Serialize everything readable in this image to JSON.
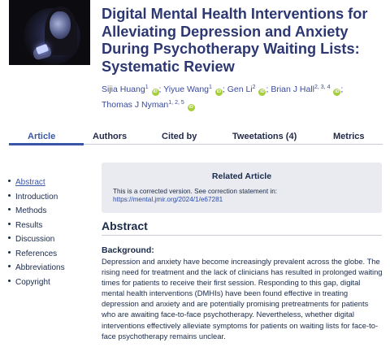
{
  "article": {
    "title": "Digital Mental Health Interventions for Alleviating Depression and Anxiety During Psychotherapy Waiting Lists: Systematic Review",
    "thumbnail_icon": "person-with-phone-image"
  },
  "authors": [
    {
      "name": "Sijia Huang",
      "sup": "1"
    },
    {
      "name": "Yiyue Wang",
      "sup": "1"
    },
    {
      "name": "Gen Li",
      "sup": "2"
    },
    {
      "name": "Brian J Hall",
      "sup": "2, 3, 4"
    },
    {
      "name": "Thomas J Nyman",
      "sup": "1, 2, 5"
    }
  ],
  "orcid_label": "iD",
  "tabs": [
    {
      "label": "Article",
      "active": true
    },
    {
      "label": "Authors"
    },
    {
      "label": "Cited by"
    },
    {
      "label": "Tweetations (4)"
    },
    {
      "label": "Metrics"
    }
  ],
  "toc": [
    {
      "label": "Abstract",
      "active": true
    },
    {
      "label": "Introduction"
    },
    {
      "label": "Methods"
    },
    {
      "label": "Results"
    },
    {
      "label": "Discussion"
    },
    {
      "label": "References"
    },
    {
      "label": "Abbreviations"
    },
    {
      "label": "Copyright"
    }
  ],
  "related": {
    "heading": "Related Article",
    "note": "This is a corrected version. See correction statement in:",
    "link": "https://mental.jmir.org/2024/1/e67281"
  },
  "abstract": {
    "heading": "Abstract",
    "background_heading": "Background:",
    "background_text": "Depression and anxiety have become increasingly prevalent across the globe. The rising need for treatment and the lack of clinicians has resulted in prolonged waiting times for patients to receive their first session. Responding to this gap, digital mental health interventions (DMHIs) have been found effective in treating depression and anxiety and are potentially promising pretreatments for patients who are awaiting face-to-face psychotherapy. Nevertheless, whether digital interventions effectively alleviate symptoms for patients on waiting lists for face-to-face psychotherapy remains unclear."
  },
  "colors": {
    "title": "#2d3873",
    "link": "#3a56a8",
    "orcid": "#a6ce39",
    "panel": "#e9ebf0"
  }
}
